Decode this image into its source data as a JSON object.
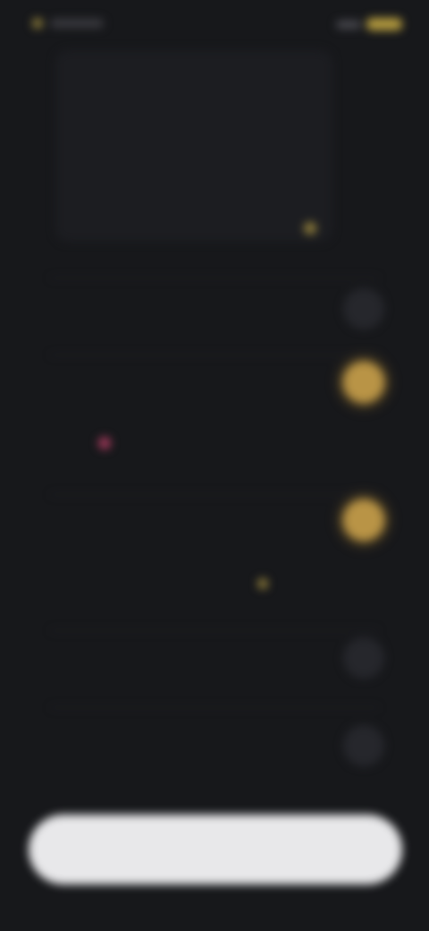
{
  "status_bar": {
    "time": "",
    "battery": ""
  },
  "header": {
    "title": "",
    "subtitle": ""
  },
  "options": [
    {
      "title": "",
      "description": "",
      "selected": false
    },
    {
      "title": "",
      "description": "",
      "selected": true
    },
    {
      "title": "",
      "description": "",
      "selected": true
    },
    {
      "title": "",
      "description": "",
      "selected": false
    },
    {
      "title": "",
      "description": "",
      "selected": false
    }
  ],
  "footer": {
    "continue_label": ""
  },
  "colors": {
    "background": "#17181b",
    "accent": "#b99446",
    "button": "#e8e8ea"
  }
}
